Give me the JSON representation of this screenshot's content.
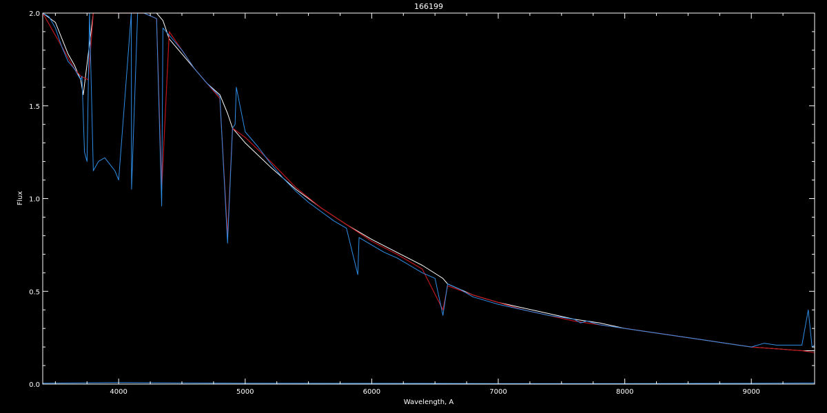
{
  "chart_data": {
    "type": "line",
    "title": "166199",
    "xlabel": "Wavelength, A",
    "ylabel": "Flux",
    "xlim": [
      3400,
      9500
    ],
    "ylim": [
      0.0,
      2.0
    ],
    "x_ticks": [
      4000,
      5000,
      6000,
      7000,
      8000,
      9000
    ],
    "x_tick_labels": [
      "4000",
      "5000",
      "6000",
      "7000",
      "8000",
      "9000"
    ],
    "y_ticks": [
      0.0,
      0.5,
      1.0,
      1.5,
      2.0
    ],
    "y_tick_labels": [
      "0.0",
      "0.5",
      "1.0",
      "1.5",
      "2.0"
    ],
    "grid": false,
    "background_color": "#000000",
    "series": [
      {
        "color": "#ffffff",
        "x": [
          3400,
          3500,
          3600,
          3650,
          3700,
          3720,
          3800,
          3900,
          4000,
          4100,
          4200,
          4300,
          4350,
          4400,
          4500,
          4600,
          4700,
          4800,
          4860,
          4900,
          5000,
          5200,
          5400,
          5600,
          5800,
          6000,
          6200,
          6400,
          6562,
          6600,
          6800,
          7000,
          7200,
          7400,
          7600,
          7800,
          8000,
          8200,
          8400,
          8600,
          8800,
          9000,
          9200,
          9400,
          9500
        ],
        "y": [
          2.0,
          1.95,
          1.78,
          1.72,
          1.64,
          1.56,
          2.0,
          2.0,
          2.0,
          2.0,
          2.0,
          2.0,
          1.96,
          1.86,
          1.78,
          1.7,
          1.62,
          1.56,
          1.46,
          1.38,
          1.3,
          1.17,
          1.05,
          0.95,
          0.86,
          0.78,
          0.71,
          0.64,
          0.57,
          0.54,
          0.48,
          0.44,
          0.41,
          0.38,
          0.35,
          0.33,
          0.3,
          0.28,
          0.26,
          0.24,
          0.22,
          0.2,
          0.19,
          0.18,
          0.18
        ]
      },
      {
        "color": "#c0141a",
        "x": [
          3400,
          3500,
          3600,
          3650,
          3700,
          3760,
          3800,
          4000,
          4200,
          4300,
          4340,
          4400,
          4500,
          4600,
          4700,
          4800,
          4861,
          4900,
          5000,
          5200,
          5400,
          5600,
          5800,
          6000,
          6200,
          6400,
          6563,
          6600,
          6800,
          7000,
          7200,
          7400,
          7600,
          7800,
          8000,
          8200,
          8400,
          8600,
          8800,
          9000,
          9200,
          9400,
          9500
        ],
        "y": [
          2.0,
          1.88,
          1.76,
          1.7,
          1.66,
          1.64,
          2.0,
          2.0,
          2.0,
          1.97,
          1.05,
          1.9,
          1.8,
          1.7,
          1.62,
          1.54,
          0.8,
          1.38,
          1.33,
          1.2,
          1.06,
          0.95,
          0.86,
          0.77,
          0.7,
          0.62,
          0.4,
          0.53,
          0.48,
          0.44,
          0.4,
          0.37,
          0.34,
          0.32,
          0.3,
          0.28,
          0.26,
          0.24,
          0.22,
          0.2,
          0.19,
          0.18,
          0.17
        ]
      },
      {
        "color": "#2f8fe8",
        "x": [
          3400,
          3450,
          3500,
          3550,
          3600,
          3650,
          3700,
          3710,
          3730,
          3750,
          3770,
          3800,
          3840,
          3890,
          3970,
          4000,
          4100,
          4102,
          4150,
          4200,
          4300,
          4340,
          4350,
          4400,
          4500,
          4600,
          4700,
          4800,
          4861,
          4900,
          4920,
          4930,
          5000,
          5100,
          5200,
          5300,
          5400,
          5500,
          5600,
          5700,
          5800,
          5890,
          5900,
          6000,
          6100,
          6200,
          6300,
          6400,
          6500,
          6563,
          6600,
          6700,
          6800,
          6900,
          7000,
          7200,
          7400,
          7600,
          7650,
          7700,
          7800,
          8000,
          8200,
          8400,
          8600,
          8800,
          9000,
          9100,
          9200,
          9300,
          9400,
          9450,
          9480,
          9500
        ],
        "y": [
          2.0,
          1.98,
          1.92,
          1.82,
          1.74,
          1.7,
          1.64,
          1.66,
          1.25,
          1.2,
          2.0,
          1.15,
          1.2,
          1.22,
          1.15,
          1.1,
          2.0,
          1.05,
          2.0,
          2.0,
          1.97,
          0.96,
          1.92,
          1.88,
          1.8,
          1.7,
          1.62,
          1.55,
          0.76,
          1.38,
          1.4,
          1.6,
          1.36,
          1.28,
          1.19,
          1.11,
          1.04,
          0.98,
          0.93,
          0.88,
          0.84,
          0.59,
          0.79,
          0.75,
          0.71,
          0.68,
          0.64,
          0.6,
          0.57,
          0.37,
          0.54,
          0.51,
          0.47,
          0.45,
          0.43,
          0.4,
          0.37,
          0.35,
          0.33,
          0.34,
          0.32,
          0.3,
          0.28,
          0.26,
          0.24,
          0.22,
          0.2,
          0.22,
          0.21,
          0.21,
          0.21,
          0.4,
          0.2,
          0.21
        ]
      },
      {
        "color": "#2f8fe8",
        "x": [
          3400,
          4000,
          5000,
          6000,
          7000,
          8000,
          9000,
          9500
        ],
        "y": [
          0.005,
          0.008,
          0.005,
          0.004,
          0.003,
          0.003,
          0.004,
          0.006
        ]
      }
    ]
  }
}
